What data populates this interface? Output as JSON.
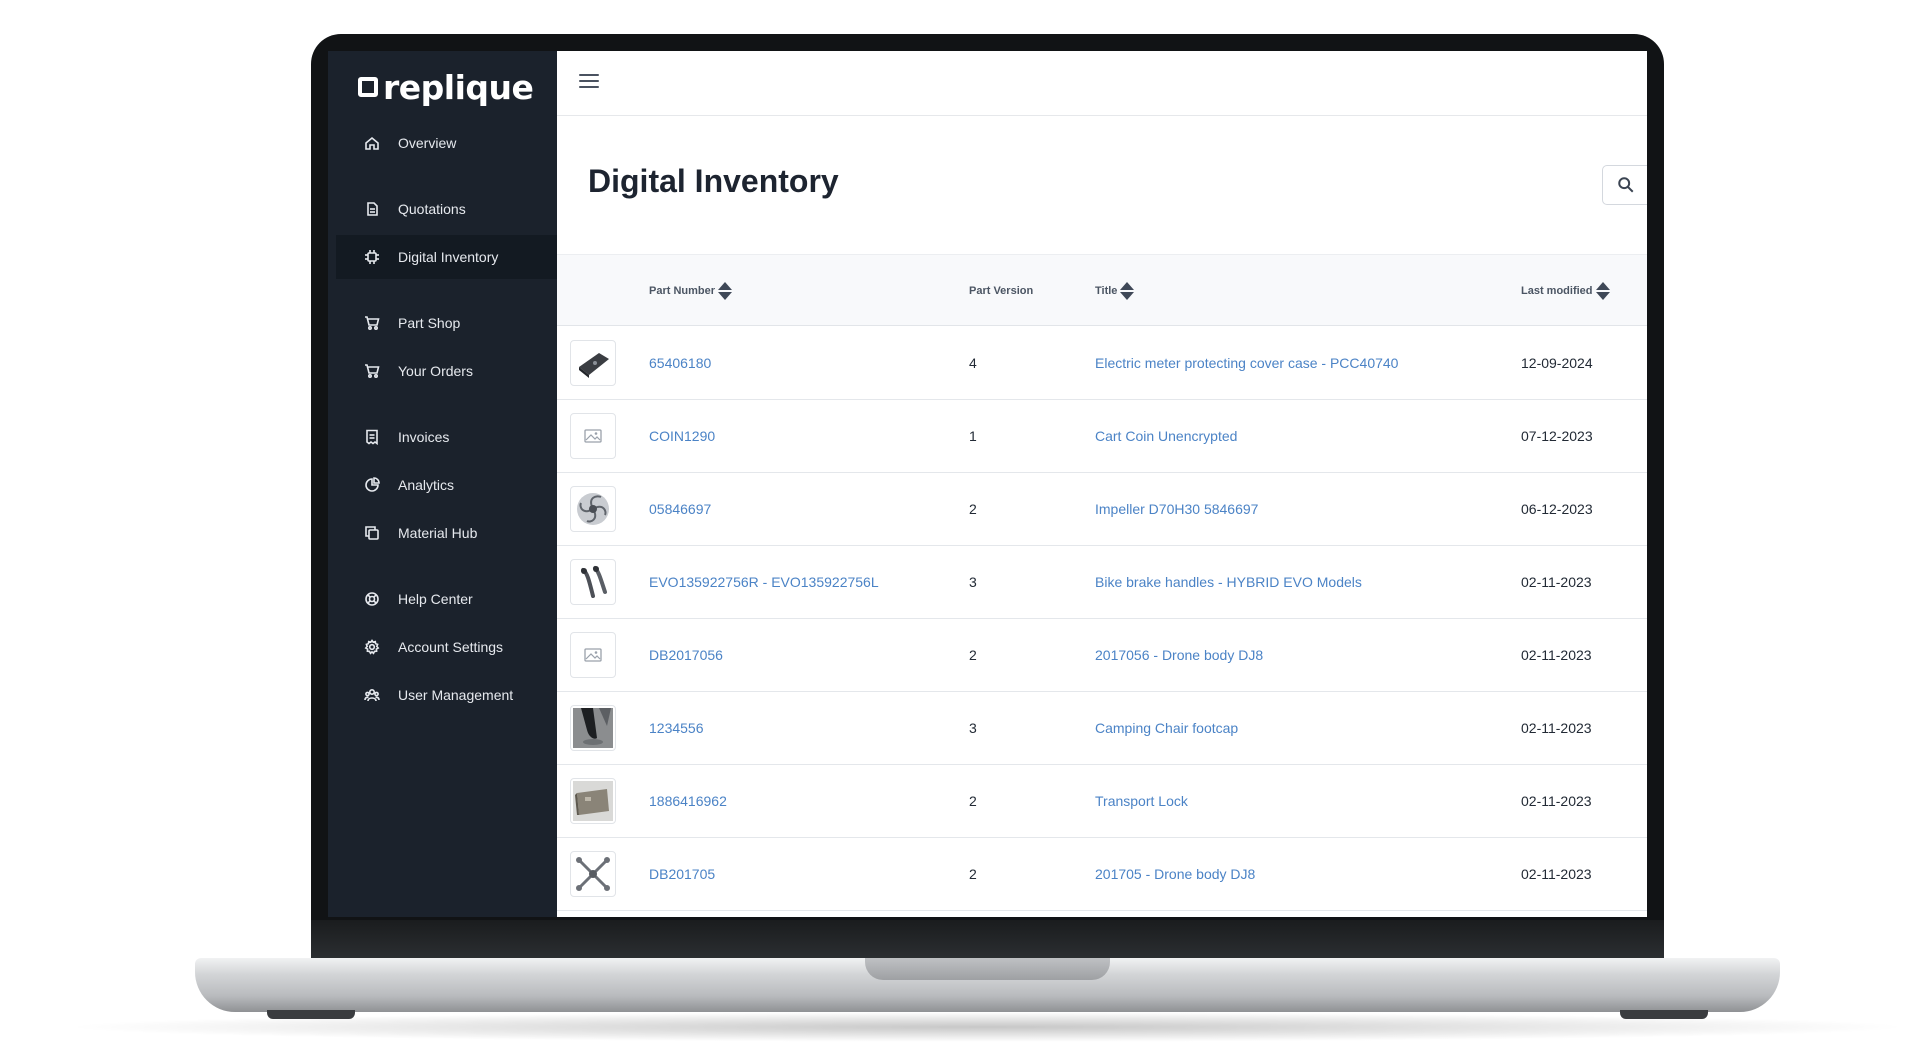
{
  "sidebar": {
    "logo": "replique",
    "items": [
      {
        "label": "Overview",
        "icon": "home-icon"
      },
      {
        "label": "Quotations",
        "icon": "document-icon"
      },
      {
        "label": "Digital Inventory",
        "icon": "chip-icon",
        "active": true
      },
      {
        "label": "Part Shop",
        "icon": "cart-icon"
      },
      {
        "label": "Your Orders",
        "icon": "cart-icon"
      },
      {
        "label": "Invoices",
        "icon": "receipt-icon"
      },
      {
        "label": "Analytics",
        "icon": "pie-chart-icon"
      },
      {
        "label": "Material Hub",
        "icon": "copy-icon"
      },
      {
        "label": "Help Center",
        "icon": "lifebuoy-icon"
      },
      {
        "label": "Account Settings",
        "icon": "gear-icon"
      },
      {
        "label": "User Management",
        "icon": "users-icon"
      }
    ]
  },
  "main": {
    "title": "Digital Inventory",
    "table": {
      "headers": {
        "part_number": "Part Number",
        "part_version": "Part Version",
        "title": "Title",
        "last_modified": "Last modified"
      },
      "rows": [
        {
          "part_number": "65406180",
          "version": "4",
          "title": "Electric meter protecting cover case - PCC40740",
          "modified": "12-09-2024",
          "thumb": "cover-case-image"
        },
        {
          "part_number": "COIN1290",
          "version": "1",
          "title": "Cart Coin Unencrypted",
          "modified": "07-12-2023",
          "thumb": "placeholder-image"
        },
        {
          "part_number": "05846697",
          "version": "2",
          "title": "Impeller D70H30 5846697",
          "modified": "06-12-2023",
          "thumb": "impeller-image"
        },
        {
          "part_number": "EVO135922756R - EVO135922756L",
          "version": "3",
          "title": "Bike brake handles - HYBRID EVO Models",
          "modified": "02-11-2023",
          "thumb": "brake-handles-image"
        },
        {
          "part_number": "DB2017056",
          "version": "2",
          "title": "2017056 - Drone body DJ8",
          "modified": "02-11-2023",
          "thumb": "placeholder-image"
        },
        {
          "part_number": "1234556",
          "version": "3",
          "title": "Camping Chair footcap",
          "modified": "02-11-2023",
          "thumb": "footcap-image"
        },
        {
          "part_number": "1886416962",
          "version": "2",
          "title": "Transport Lock",
          "modified": "02-11-2023",
          "thumb": "transport-lock-image"
        },
        {
          "part_number": "DB201705",
          "version": "2",
          "title": "201705 - Drone body DJ8",
          "modified": "02-11-2023",
          "thumb": "drone-frame-image"
        }
      ]
    }
  }
}
